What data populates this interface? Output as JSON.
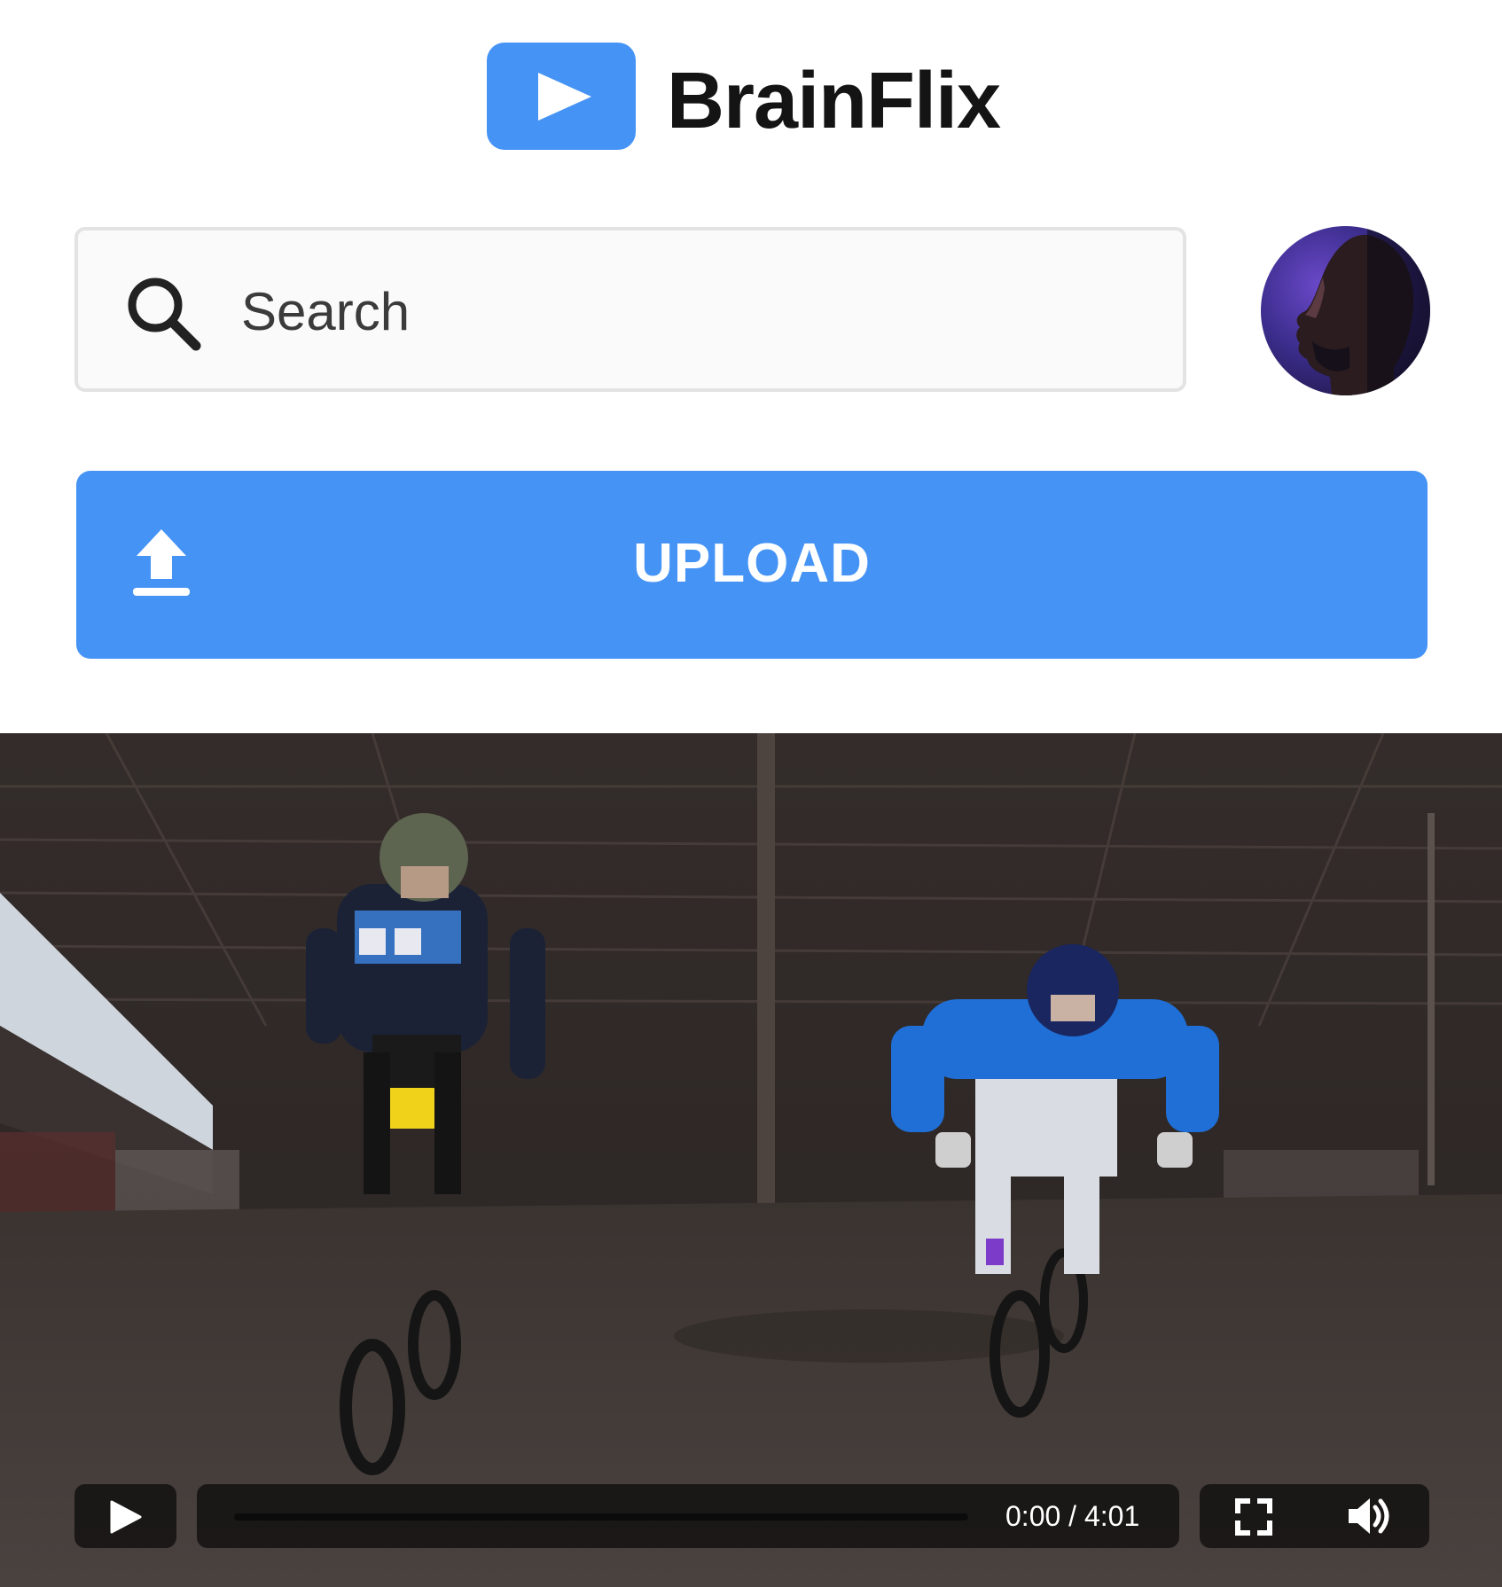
{
  "app": {
    "name": "BrainFlix",
    "logo_icon": "play-icon",
    "brand_color": "#4593f5"
  },
  "search": {
    "placeholder": "Search",
    "value": "",
    "icon": "search-icon"
  },
  "user": {
    "avatar": "user-avatar"
  },
  "upload": {
    "label": "UPLOAD",
    "icon": "upload-icon"
  },
  "player": {
    "poster": "bmx-riders-indoor-track",
    "play_icon": "play-icon",
    "progress_fraction": 0.0,
    "time_display": "0:00 / 4:01",
    "fullscreen_icon": "fullscreen-icon",
    "volume_icon": "volume-icon"
  }
}
